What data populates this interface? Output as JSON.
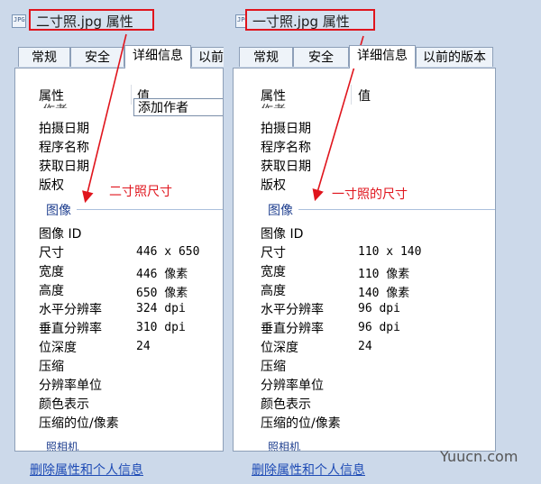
{
  "left": {
    "title": "二寸照.jpg 属性",
    "tabs": [
      "常规",
      "安全",
      "详细信息",
      "以前"
    ],
    "active_tab": 2,
    "header": {
      "name": "属性",
      "value": "值"
    },
    "top_value": "添加作者",
    "cut_top": "作者",
    "items_before": [
      "拍摄日期",
      "程序名称",
      "获取日期",
      "版权"
    ],
    "group": "图像",
    "rows": [
      {
        "name": "图像 ID",
        "value": ""
      },
      {
        "name": "尺寸",
        "value": "446 x 650"
      },
      {
        "name": "宽度",
        "value": "446 像素"
      },
      {
        "name": "高度",
        "value": "650 像素"
      },
      {
        "name": "水平分辨率",
        "value": "324 dpi"
      },
      {
        "name": "垂直分辨率",
        "value": "310 dpi"
      },
      {
        "name": "位深度",
        "value": "24"
      },
      {
        "name": "压缩",
        "value": ""
      },
      {
        "name": "分辨率单位",
        "value": ""
      },
      {
        "name": "颜色表示",
        "value": ""
      },
      {
        "name": "压缩的位/像素",
        "value": ""
      }
    ],
    "cut_bottom": "照相机",
    "link": "删除属性和个人信息",
    "annotation": "二寸照尺寸"
  },
  "right": {
    "title": "一寸照.jpg 属性",
    "tabs": [
      "常规",
      "安全",
      "详细信息",
      "以前的版本"
    ],
    "active_tab": 2,
    "header": {
      "name": "属性",
      "value": "值"
    },
    "cut_top": "作者",
    "items_before": [
      "拍摄日期",
      "程序名称",
      "获取日期",
      "版权"
    ],
    "group": "图像",
    "rows": [
      {
        "name": "图像 ID",
        "value": ""
      },
      {
        "name": "尺寸",
        "value": "110 x 140"
      },
      {
        "name": "宽度",
        "value": "110 像素"
      },
      {
        "name": "高度",
        "value": "140 像素"
      },
      {
        "name": "水平分辨率",
        "value": "96 dpi"
      },
      {
        "name": "垂直分辨率",
        "value": "96 dpi"
      },
      {
        "name": "位深度",
        "value": "24"
      },
      {
        "name": "压缩",
        "value": ""
      },
      {
        "name": "分辨率单位",
        "value": ""
      },
      {
        "name": "颜色表示",
        "value": ""
      },
      {
        "name": "压缩的位/像素",
        "value": ""
      }
    ],
    "cut_bottom": "照相机",
    "link": "删除属性和个人信息",
    "annotation": "一寸照的尺寸"
  },
  "watermark": "Yuucn.com",
  "colors": {
    "annotation": "#e0151d",
    "link": "#1e4bb5",
    "group": "#1f3f8f",
    "dialog": "#ccd9ea"
  }
}
